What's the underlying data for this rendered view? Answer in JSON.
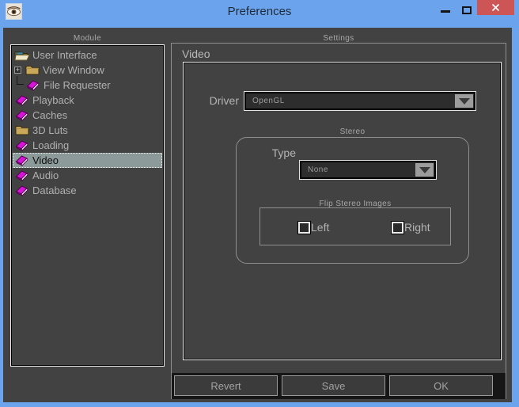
{
  "window": {
    "title": "Preferences",
    "controls": {
      "minimize": "minimize",
      "maximize": "maximize",
      "close": "close"
    }
  },
  "colors": {
    "titlebar_blue": "#6ba4ec",
    "close_red": "#cd5555",
    "content_bg": "#424242",
    "selection_bg": "#8d9a9a",
    "book_icon_magenta": "#d616d6",
    "folder_tan": "#c9a959",
    "label_gray": "#b4b4b4"
  },
  "module_panel": {
    "caption": "Module",
    "items": [
      {
        "label": "User Interface",
        "icon": "open-folder-icon",
        "expander": false,
        "connector": false,
        "selected": false
      },
      {
        "label": "View Window",
        "icon": "closed-folder-icon",
        "expander": true,
        "connector": false,
        "selected": false
      },
      {
        "label": "File Requester",
        "icon": "book-icon",
        "expander": false,
        "connector": true,
        "selected": false
      },
      {
        "label": "Playback",
        "icon": "book-icon",
        "expander": false,
        "connector": false,
        "selected": false
      },
      {
        "label": "Caches",
        "icon": "book-icon",
        "expander": false,
        "connector": false,
        "selected": false
      },
      {
        "label": "3D Luts",
        "icon": "closed-folder-icon",
        "expander": false,
        "connector": false,
        "selected": false
      },
      {
        "label": "Loading",
        "icon": "book-icon",
        "expander": false,
        "connector": false,
        "selected": false
      },
      {
        "label": "Video",
        "icon": "book-icon",
        "expander": false,
        "connector": false,
        "selected": true
      },
      {
        "label": "Audio",
        "icon": "book-icon",
        "expander": false,
        "connector": false,
        "selected": false
      },
      {
        "label": "Database",
        "icon": "book-icon",
        "expander": false,
        "connector": false,
        "selected": false
      }
    ]
  },
  "settings_panel": {
    "caption": "Settings",
    "group_label": "Video",
    "driver": {
      "label": "Driver",
      "value": "OpenGL"
    },
    "stereo": {
      "caption": "Stereo",
      "type": {
        "label": "Type",
        "value": "None"
      },
      "flip": {
        "caption": "Flip Stereo Images",
        "checkboxes": [
          {
            "label": "Left",
            "checked": false
          },
          {
            "label": "Right",
            "checked": false
          }
        ]
      }
    }
  },
  "footer": {
    "buttons": [
      "Revert",
      "Save",
      "OK"
    ]
  }
}
